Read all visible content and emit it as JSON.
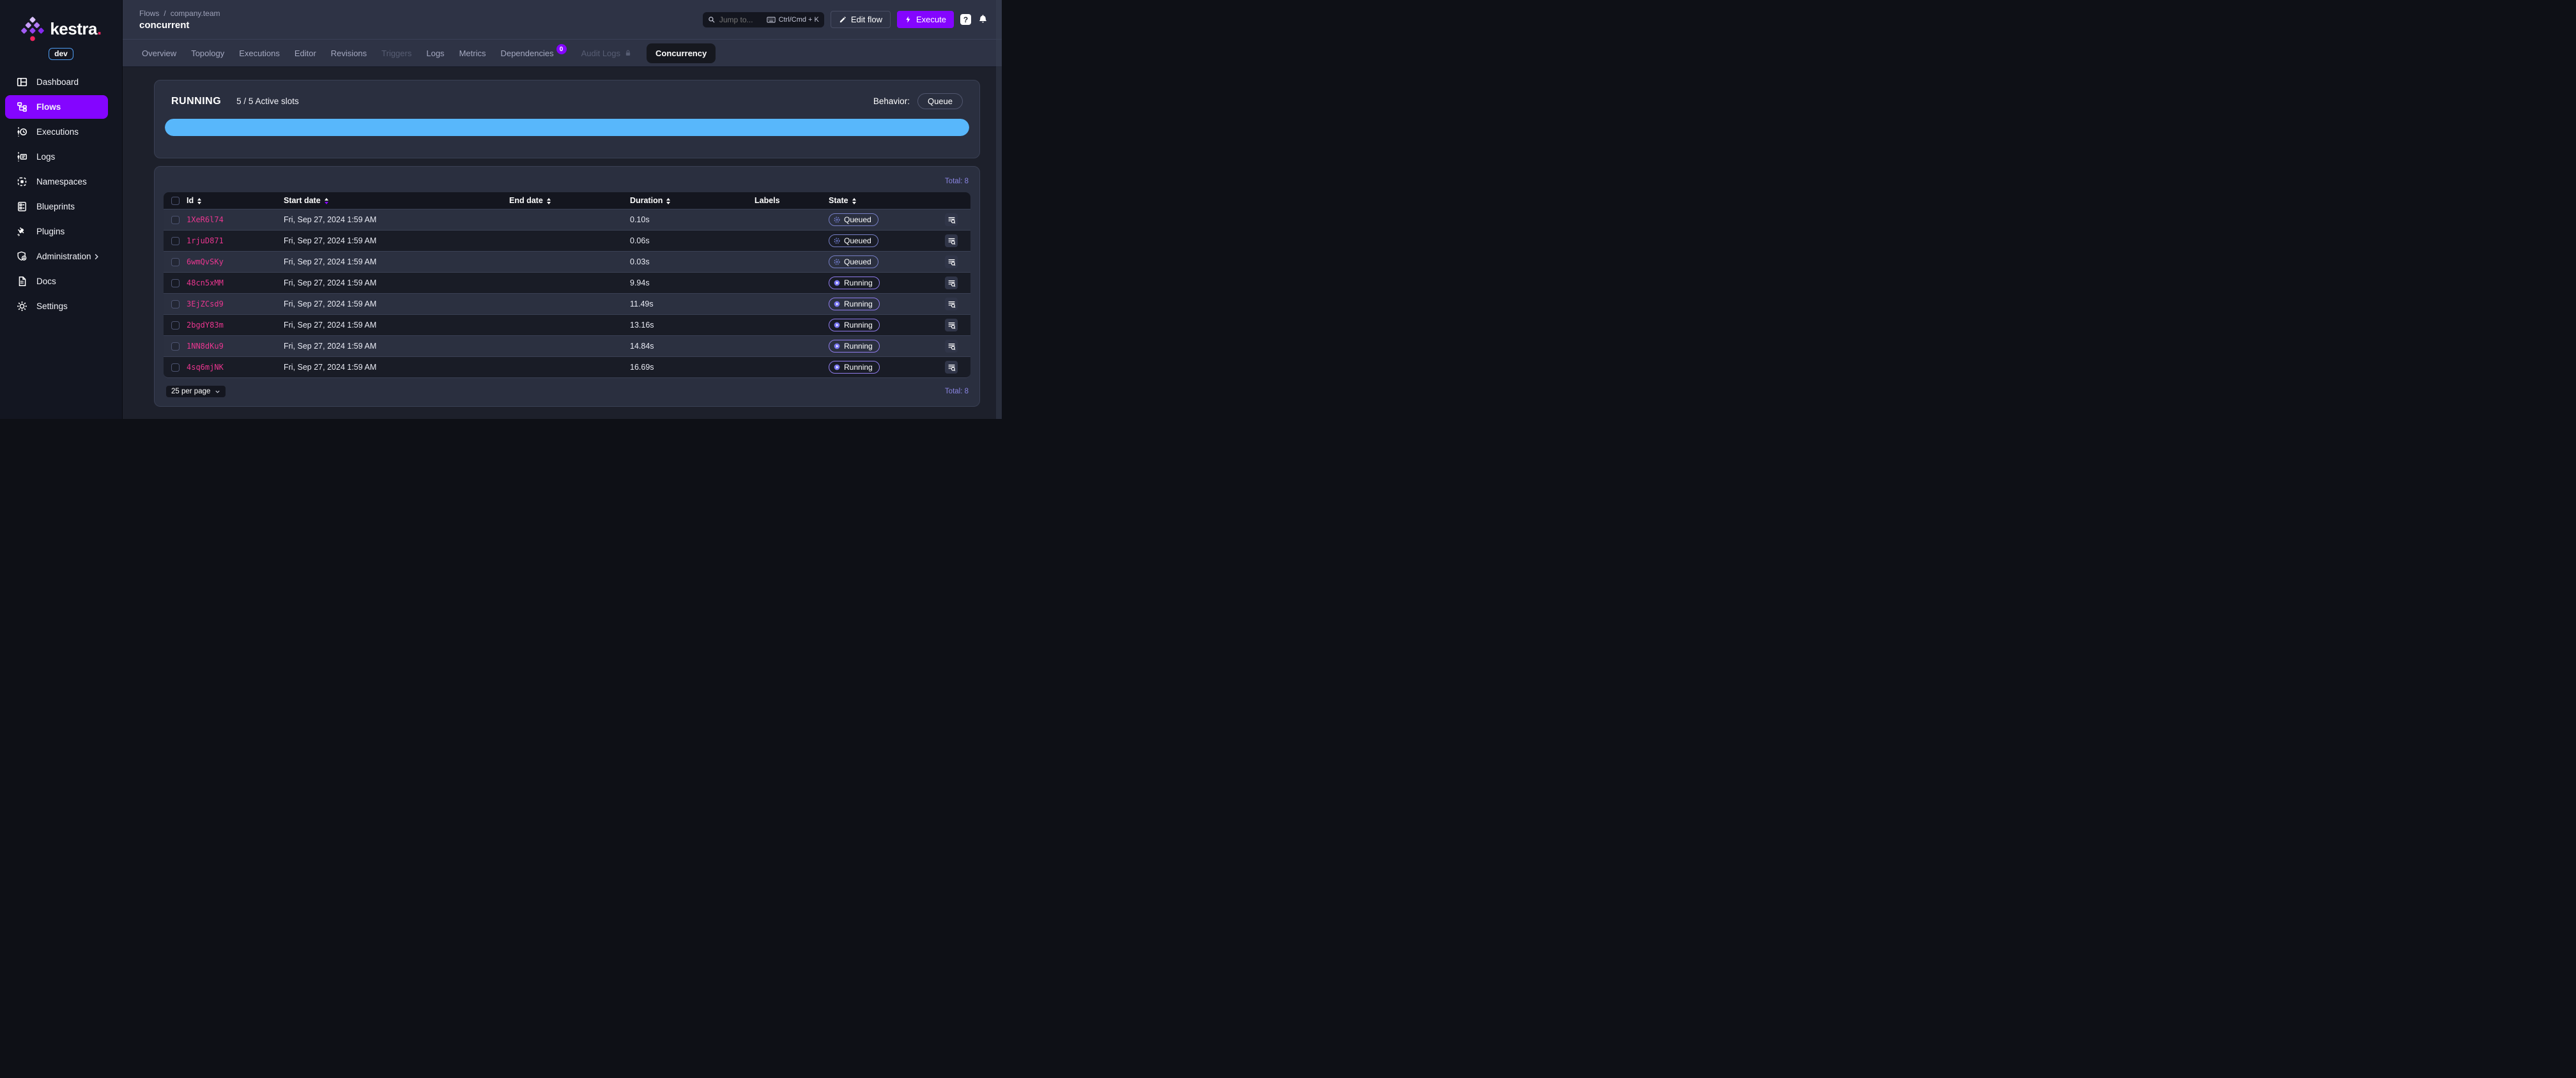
{
  "colors": {
    "accent_purple": "#8405ff",
    "slot_bar_blue": "#58b7fb",
    "id_pink": "#e8368f",
    "queued_icon": "#7e8be8",
    "running_icon": "#7b78f2",
    "total_purple": "#8a85e2",
    "env_badge_border": "#4e9bf0"
  },
  "sidebar": {
    "logo_text": "kestra",
    "logo_dot": ".",
    "env_badge": "dev",
    "items": [
      {
        "label": "Dashboard"
      },
      {
        "label": "Flows",
        "active": true
      },
      {
        "label": "Executions"
      },
      {
        "label": "Logs"
      },
      {
        "label": "Namespaces"
      },
      {
        "label": "Blueprints"
      },
      {
        "label": "Plugins"
      },
      {
        "label": "Administration",
        "expandable": true
      },
      {
        "label": "Docs"
      },
      {
        "label": "Settings"
      }
    ]
  },
  "topbar": {
    "breadcrumb": {
      "root": "Flows",
      "separator": "/",
      "namespace": "company.team"
    },
    "title": "concurrent",
    "search": {
      "placeholder": "Jump to...",
      "shortcut": "Ctrl/Cmd + K"
    },
    "edit_flow_label": "Edit flow",
    "execute_label": "Execute",
    "help_glyph": "?"
  },
  "tabs": [
    {
      "label": "Overview"
    },
    {
      "label": "Topology"
    },
    {
      "label": "Executions"
    },
    {
      "label": "Editor"
    },
    {
      "label": "Revisions"
    },
    {
      "label": "Triggers",
      "disabled": true
    },
    {
      "label": "Logs"
    },
    {
      "label": "Metrics"
    },
    {
      "label": "Dependencies",
      "badge": "0"
    },
    {
      "label": "Audit Logs",
      "disabled": true,
      "locked": true
    },
    {
      "label": "Concurrency",
      "active": true
    }
  ],
  "concurrency": {
    "state_title": "RUNNING",
    "slots_text": "5 / 5 Active slots",
    "active_slots": 5,
    "total_slots": 5,
    "progress_pct": 100,
    "behavior_label": "Behavior:",
    "behavior_value": "Queue"
  },
  "table": {
    "total": "Total: 8",
    "columns": {
      "id": "Id",
      "start_date": "Start date",
      "end_date": "End date",
      "duration": "Duration",
      "labels": "Labels",
      "state": "State"
    },
    "sorted_column": "start_date",
    "sorted_direction": "desc",
    "rows": [
      {
        "id": "1XeR6l74",
        "start_date": "Fri, Sep 27, 2024 1:59 AM",
        "end_date": "",
        "duration": "0.10s",
        "labels": "",
        "state": "Queued"
      },
      {
        "id": "1rjuD871",
        "start_date": "Fri, Sep 27, 2024 1:59 AM",
        "end_date": "",
        "duration": "0.06s",
        "labels": "",
        "state": "Queued"
      },
      {
        "id": "6wmQvSKy",
        "start_date": "Fri, Sep 27, 2024 1:59 AM",
        "end_date": "",
        "duration": "0.03s",
        "labels": "",
        "state": "Queued"
      },
      {
        "id": "48cn5xMM",
        "start_date": "Fri, Sep 27, 2024 1:59 AM",
        "end_date": "",
        "duration": "9.94s",
        "labels": "",
        "state": "Running"
      },
      {
        "id": "3EjZCsd9",
        "start_date": "Fri, Sep 27, 2024 1:59 AM",
        "end_date": "",
        "duration": "11.49s",
        "labels": "",
        "state": "Running"
      },
      {
        "id": "2bgdY83m",
        "start_date": "Fri, Sep 27, 2024 1:59 AM",
        "end_date": "",
        "duration": "13.16s",
        "labels": "",
        "state": "Running"
      },
      {
        "id": "1NN8dKu9",
        "start_date": "Fri, Sep 27, 2024 1:59 AM",
        "end_date": "",
        "duration": "14.84s",
        "labels": "",
        "state": "Running"
      },
      {
        "id": "4sq6mjNK",
        "start_date": "Fri, Sep 27, 2024 1:59 AM",
        "end_date": "",
        "duration": "16.69s",
        "labels": "",
        "state": "Running"
      }
    ],
    "pagination": {
      "per_page": "25 per page"
    }
  }
}
